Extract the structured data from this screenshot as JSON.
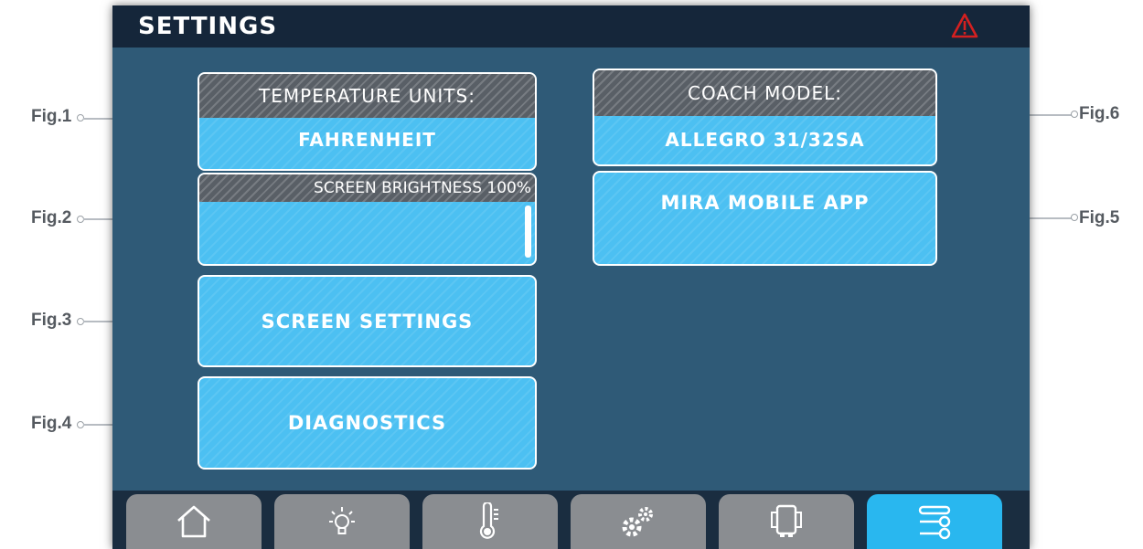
{
  "header": {
    "title": "SETTINGS",
    "alert_icon": "warning-triangle-icon",
    "alert_color": "#d42020"
  },
  "tiles": {
    "temperature_units": {
      "label": "TEMPERATURE UNITS:",
      "value": "FAHRENHEIT"
    },
    "screen_brightness": {
      "label": "SCREEN BRIGHTNESS 100%",
      "level_percent": 100
    },
    "screen_settings": {
      "label": "SCREEN SETTINGS"
    },
    "diagnostics": {
      "label": "DIAGNOSTICS"
    },
    "coach_model": {
      "label": "COACH MODEL:",
      "value": "ALLEGRO 31/32SA"
    },
    "mira_mobile_app": {
      "label": "MIRA MOBILE APP"
    }
  },
  "navbar": {
    "items": [
      {
        "icon": "home-icon",
        "active": false
      },
      {
        "icon": "lightbulb-icon",
        "active": false
      },
      {
        "icon": "thermometer-icon",
        "active": false
      },
      {
        "icon": "gears-icon",
        "active": false
      },
      {
        "icon": "slide-out-icon",
        "active": false
      },
      {
        "icon": "settings-sliders-icon",
        "active": true
      }
    ]
  },
  "callouts": {
    "fig1": "Fig.1",
    "fig2": "Fig.2",
    "fig3": "Fig.3",
    "fig4": "Fig.4",
    "fig5": "Fig.5",
    "fig6": "Fig.6"
  },
  "colors": {
    "screen_bg": "#2f5a77",
    "tile": "#4cc0f2",
    "tile_header": "#595f66",
    "nav_active": "#29b7ef",
    "nav_inactive": "#8a8d91"
  }
}
